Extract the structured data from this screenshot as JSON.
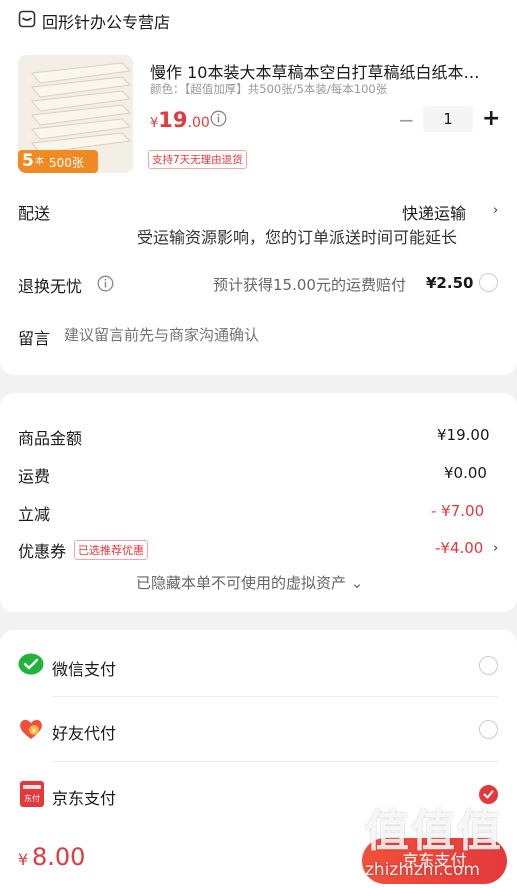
{
  "shop": {
    "name": "回形针办公专营店",
    "icon": "shop-icon"
  },
  "product": {
    "title": "慢作 10本装大本草稿本空白打草稿纸白纸本…",
    "spec": "颜色：【超值加厚】共500张/5本装/每本100张",
    "price_currency": "¥",
    "price_int": "19",
    "price_dec": ".00",
    "quantity": "1",
    "minus": "−",
    "plus": "+",
    "return_badge": "支持7天无理由退货",
    "thumb_badge_count": "5",
    "thumb_badge_unit": "本",
    "thumb_badge_sheets": "500张"
  },
  "delivery": {
    "label": "配送",
    "method": "快递运输",
    "notice": "受运输资源影响，您的订单派送时间可能延长"
  },
  "return_worry_free": {
    "label": "退换无忧",
    "desc": "预计获得15.00元的运费赔付",
    "price": "¥2.50"
  },
  "message": {
    "label": "留言",
    "placeholder": "建议留言前先与商家沟通确认"
  },
  "summary": {
    "goods_label": "商品金额",
    "goods_value": "¥19.00",
    "freight_label": "运费",
    "freight_value": "¥0.00",
    "discount_label": "立减",
    "discount_value": "- ¥7.00",
    "coupon_label": "优惠券",
    "coupon_tag": "已选推荐优惠",
    "coupon_value": "-¥4.00",
    "hidden_assets": "已隐藏本单不可使用的虚拟资产 ⌄"
  },
  "payment": {
    "options": [
      {
        "label": "微信支付",
        "icon": "wechat-pay-icon",
        "selected": false
      },
      {
        "label": "好友代付",
        "icon": "friend-pay-icon",
        "selected": false
      },
      {
        "label": "京东支付",
        "icon": "jd-pay-icon",
        "selected": true
      }
    ],
    "jd_icon_text": "东付"
  },
  "footer": {
    "total_currency": "¥",
    "total": "8.00",
    "pay_button": "京东支付"
  },
  "watermark": {
    "text": "值值值",
    "url": "zhizhizhi.com"
  },
  "colors": {
    "accent": "#e4393c",
    "wechat": "#22b33c"
  }
}
